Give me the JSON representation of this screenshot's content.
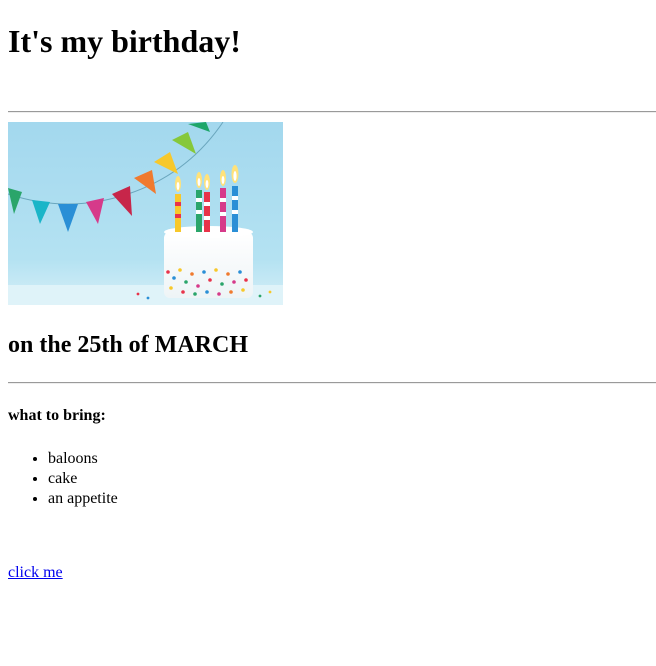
{
  "page": {
    "title": "It's my birthday!",
    "subtitle": "on the 25th of MARCH",
    "bring_heading": "what to bring:",
    "bring_items": [
      "baloons",
      "cake",
      "an appetite"
    ],
    "link_text": "click me"
  },
  "image": {
    "subject": "birthday-cake-with-candles-and-bunting",
    "background_color": "#a7dcef"
  },
  "colors": {
    "link": "#0000ee",
    "text": "#000000",
    "rule": "#9a9a9a"
  }
}
